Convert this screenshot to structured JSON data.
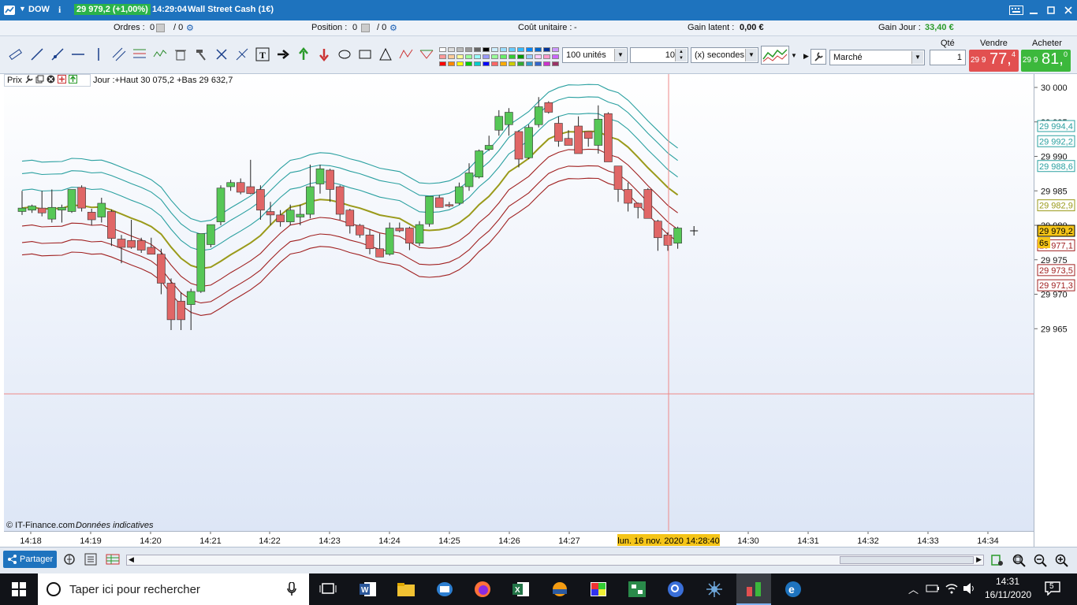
{
  "titlebar": {
    "symbol": "DOW",
    "price_badge": "29 979,2 (+1,00%)",
    "time": "14:29:04",
    "instrument": "Wall Street Cash (1€)"
  },
  "infobar": {
    "orders_label": "Ordres :",
    "orders_value": "0",
    "orders_value2": "/ 0",
    "position_label": "Position :",
    "position_value": "0",
    "position_value2": "/ 0",
    "unit_cost_label": "Coût unitaire :",
    "unit_cost_value": "-",
    "latent_label": "Gain latent :",
    "latent_value": "0,00 €",
    "day_gain_label": "Gain Jour :",
    "day_gain_value": "33,40 €"
  },
  "toolbar": {
    "units_select": "100 unités",
    "interval_value": "10",
    "interval_unit": "(x) secondes",
    "order_type": "Marché",
    "qty_label": "Qté",
    "qty_value": "1",
    "sell_label": "Vendre",
    "buy_label": "Acheter",
    "sell_price_small": "29 9",
    "sell_price_big": "77,",
    "sell_price_sup": "4",
    "buy_price_small": "29 9",
    "buy_price_big": "81,",
    "buy_price_sup": "0"
  },
  "chart_header": {
    "prix_label": "Prix",
    "day_info": "Jour :+Haut 30 075,2 +Bas 29 632,7"
  },
  "credits": {
    "source": "© IT-Finance.com",
    "note": "Données indicatives"
  },
  "yaxis": {
    "ticks": [
      "30 000",
      "29 995",
      "29 990",
      "29 985",
      "29 980",
      "29 975",
      "29 970",
      "29 965"
    ],
    "badges": [
      {
        "text": "29 994,4",
        "color": "#2aa0a0",
        "value": 29994.4
      },
      {
        "text": "29 992,2",
        "color": "#2aa0a0",
        "value": 29992.2
      },
      {
        "text": "29 988,6",
        "color": "#2aa0a0",
        "value": 29988.6
      },
      {
        "text": "29 982,9",
        "color": "#9a9a1a",
        "value": 29982.9
      },
      {
        "text": "29 979,2",
        "color": "#000000",
        "value": 29979.2
      },
      {
        "text": "29 977,1",
        "color": "#a02020",
        "value": 29977.1
      },
      {
        "text": "29 973,5",
        "color": "#a02020",
        "value": 29973.5
      },
      {
        "text": "29 971,3",
        "color": "#a02020",
        "value": 29971.3
      }
    ],
    "countdown": "6s"
  },
  "xaxis": {
    "ticks": [
      "14:18",
      "14:19",
      "14:20",
      "14:21",
      "14:22",
      "14:23",
      "14:24",
      "14:25",
      "14:26",
      "14:27",
      "14:30",
      "14:31",
      "14:32",
      "14:33",
      "14:34"
    ],
    "cursor_label": "lun. 16 nov. 2020 14:28:40"
  },
  "bottombar": {
    "share_label": "Partager"
  },
  "taskbar": {
    "search_placeholder": "Taper ici pour rechercher",
    "clock_time": "14:31",
    "clock_date": "16/11/2020",
    "notif_count": "5"
  },
  "colors": {
    "bull": "#56c756",
    "bear": "#e06666",
    "band_teal": "#2aa0a0",
    "band_red": "#a02020",
    "ma": "#9a9a1a"
  },
  "chart_data": {
    "type": "candlestick",
    "x_label_note": "time (10 s candles)",
    "ylim": [
      29962,
      30002
    ],
    "candles": [
      {
        "t": "14:18:00",
        "o": 29982.0,
        "h": 29985.0,
        "l": 29981.5,
        "c": 29982.5
      },
      {
        "t": "14:18:10",
        "o": 29982.2,
        "h": 29983.0,
        "l": 29981.8,
        "c": 29982.8
      },
      {
        "t": "14:18:20",
        "o": 29982.5,
        "h": 29985.0,
        "l": 29981.3,
        "c": 29981.8
      },
      {
        "t": "14:18:30",
        "o": 29980.9,
        "h": 29985.2,
        "l": 29980.4,
        "c": 29982.6
      },
      {
        "t": "14:18:40",
        "o": 29982.2,
        "h": 29983.0,
        "l": 29980.4,
        "c": 29982.6
      },
      {
        "t": "14:18:50",
        "o": 29982.0,
        "h": 29985.2,
        "l": 29981.8,
        "c": 29985.2
      },
      {
        "t": "14:19:00",
        "o": 29985.5,
        "h": 29985.8,
        "l": 29982.0,
        "c": 29982.5
      },
      {
        "t": "14:19:10",
        "o": 29981.9,
        "h": 29982.4,
        "l": 29980.0,
        "c": 29980.8
      },
      {
        "t": "14:19:20",
        "o": 29981.2,
        "h": 29984.0,
        "l": 29980.4,
        "c": 29983.2
      },
      {
        "t": "14:19:30",
        "o": 29982.0,
        "h": 29982.3,
        "l": 29977.0,
        "c": 29978.1
      },
      {
        "t": "14:19:40",
        "o": 29978.0,
        "h": 29978.6,
        "l": 29974.5,
        "c": 29976.8
      },
      {
        "t": "14:19:50",
        "o": 29977.8,
        "h": 29980.8,
        "l": 29976.6,
        "c": 29976.8
      },
      {
        "t": "14:20:00",
        "o": 29977.8,
        "h": 29978.2,
        "l": 29976.0,
        "c": 29976.4
      },
      {
        "t": "14:20:10",
        "o": 29976.8,
        "h": 29978.2,
        "l": 29975.8,
        "c": 29975.8
      },
      {
        "t": "14:20:20",
        "o": 29975.8,
        "h": 29976.6,
        "l": 29970.0,
        "c": 29971.6
      },
      {
        "t": "14:20:30",
        "o": 29971.6,
        "h": 29972.3,
        "l": 29964.8,
        "c": 29966.3
      },
      {
        "t": "14:20:40",
        "o": 29969.0,
        "h": 29970.3,
        "l": 29964.8,
        "c": 29966.3
      },
      {
        "t": "14:20:50",
        "o": 29968.5,
        "h": 29970.8,
        "l": 29964.8,
        "c": 29970.4
      },
      {
        "t": "14:21:00",
        "o": 29970.4,
        "h": 29977.4,
        "l": 29970.2,
        "c": 29978.8
      },
      {
        "t": "14:21:10",
        "o": 29977.2,
        "h": 29980.1,
        "l": 29976.8,
        "c": 29980.1
      },
      {
        "t": "14:21:20",
        "o": 29980.5,
        "h": 29985.8,
        "l": 29980.0,
        "c": 29985.4
      },
      {
        "t": "14:21:30",
        "o": 29985.6,
        "h": 29986.6,
        "l": 29985.0,
        "c": 29986.2
      },
      {
        "t": "14:21:40",
        "o": 29986.2,
        "h": 29986.8,
        "l": 29984.5,
        "c": 29984.8
      },
      {
        "t": "14:21:50",
        "o": 29985.6,
        "h": 29989.5,
        "l": 29984.5,
        "c": 29984.6
      },
      {
        "t": "14:22:00",
        "o": 29985.2,
        "h": 29985.8,
        "l": 29980.8,
        "c": 29982.2
      },
      {
        "t": "14:22:10",
        "o": 29982.0,
        "h": 29983.4,
        "l": 29980.0,
        "c": 29981.5
      },
      {
        "t": "14:22:20",
        "o": 29981.5,
        "h": 29982.2,
        "l": 29979.8,
        "c": 29980.5
      },
      {
        "t": "14:22:30",
        "o": 29980.5,
        "h": 29983.0,
        "l": 29980.0,
        "c": 29982.2
      },
      {
        "t": "14:22:40",
        "o": 29981.2,
        "h": 29983.0,
        "l": 29980.0,
        "c": 29981.6
      },
      {
        "t": "14:22:50",
        "o": 29981.6,
        "h": 29988.8,
        "l": 29981.0,
        "c": 29985.6
      },
      {
        "t": "14:23:00",
        "o": 29986.0,
        "h": 29988.8,
        "l": 29984.6,
        "c": 29988.2
      },
      {
        "t": "14:23:10",
        "o": 29988.0,
        "h": 29988.2,
        "l": 29983.4,
        "c": 29985.2
      },
      {
        "t": "14:23:20",
        "o": 29985.6,
        "h": 29985.8,
        "l": 29980.8,
        "c": 29981.6
      },
      {
        "t": "14:23:30",
        "o": 29982.2,
        "h": 29982.4,
        "l": 29978.8,
        "c": 29979.9
      },
      {
        "t": "14:23:40",
        "o": 29980.0,
        "h": 29980.2,
        "l": 29978.2,
        "c": 29978.6
      },
      {
        "t": "14:23:50",
        "o": 29978.6,
        "h": 29979.4,
        "l": 29975.8,
        "c": 29976.6
      },
      {
        "t": "14:24:00",
        "o": 29976.6,
        "h": 29978.8,
        "l": 29975.4,
        "c": 29975.4
      },
      {
        "t": "14:24:10",
        "o": 29975.8,
        "h": 29980.4,
        "l": 29975.6,
        "c": 29979.6
      },
      {
        "t": "14:24:20",
        "o": 29979.6,
        "h": 29980.4,
        "l": 29979.0,
        "c": 29979.2
      },
      {
        "t": "14:24:30",
        "o": 29979.6,
        "h": 29979.8,
        "l": 29976.4,
        "c": 29977.4
      },
      {
        "t": "14:24:40",
        "o": 29977.4,
        "h": 29980.6,
        "l": 29977.0,
        "c": 29980.1
      },
      {
        "t": "14:24:50",
        "o": 29980.2,
        "h": 29984.2,
        "l": 29979.8,
        "c": 29984.2
      },
      {
        "t": "14:25:00",
        "o": 29984.0,
        "h": 29984.4,
        "l": 29983.0,
        "c": 29982.6
      },
      {
        "t": "14:25:10",
        "o": 29983.0,
        "h": 29983.4,
        "l": 29982.6,
        "c": 29982.8
      },
      {
        "t": "14:25:20",
        "o": 29983.2,
        "h": 29986.2,
        "l": 29983.0,
        "c": 29985.6
      },
      {
        "t": "14:25:30",
        "o": 29985.6,
        "h": 29989.0,
        "l": 29985.0,
        "c": 29987.6
      },
      {
        "t": "14:25:40",
        "o": 29987.0,
        "h": 29991.0,
        "l": 29986.8,
        "c": 29990.8
      },
      {
        "t": "14:25:50",
        "o": 29991.0,
        "h": 29993.0,
        "l": 29990.8,
        "c": 29991.6
      },
      {
        "t": "14:26:00",
        "o": 29993.8,
        "h": 29996.7,
        "l": 29993.0,
        "c": 29995.8
      },
      {
        "t": "14:26:10",
        "o": 29994.6,
        "h": 29997.0,
        "l": 29993.0,
        "c": 29996.4
      },
      {
        "t": "14:26:20",
        "o": 29993.6,
        "h": 29993.8,
        "l": 29988.4,
        "c": 29989.6
      },
      {
        "t": "14:26:30",
        "o": 29989.8,
        "h": 29994.6,
        "l": 29989.6,
        "c": 29994.2
      },
      {
        "t": "14:26:40",
        "o": 29994.6,
        "h": 29998.6,
        "l": 29994.2,
        "c": 29997.2
      },
      {
        "t": "14:26:50",
        "o": 29997.8,
        "h": 29998.0,
        "l": 29996.2,
        "c": 29996.4
      },
      {
        "t": "14:27:00",
        "o": 29994.8,
        "h": 29995.8,
        "l": 29991.4,
        "c": 29992.2
      },
      {
        "t": "14:27:10",
        "o": 29992.6,
        "h": 29993.8,
        "l": 29991.6,
        "c": 29991.6
      },
      {
        "t": "14:27:20",
        "o": 29994.4,
        "h": 29995.8,
        "l": 29990.4,
        "c": 29990.4
      },
      {
        "t": "14:27:30",
        "o": 29993.6,
        "h": 29993.4,
        "l": 29991.4,
        "c": 29992.6
      },
      {
        "t": "14:27:40",
        "o": 29991.6,
        "h": 29997.4,
        "l": 29990.4,
        "c": 29995.4
      },
      {
        "t": "14:27:50",
        "o": 29996.2,
        "h": 29996.4,
        "l": 29989.2,
        "c": 29989.2
      },
      {
        "t": "14:28:00",
        "o": 29988.6,
        "h": 29988.6,
        "l": 29983.4,
        "c": 29985.2
      },
      {
        "t": "14:28:10",
        "o": 29985.2,
        "h": 29986.2,
        "l": 29982.0,
        "c": 29983.2
      },
      {
        "t": "14:28:20",
        "o": 29983.2,
        "h": 29983.3,
        "l": 29981.0,
        "c": 29982.6
      },
      {
        "t": "14:28:30",
        "o": 29985.2,
        "h": 29985.4,
        "l": 29981.0,
        "c": 29981.0
      },
      {
        "t": "14:28:40",
        "o": 29980.6,
        "h": 29980.8,
        "l": 29976.3,
        "c": 29978.2
      },
      {
        "t": "14:28:50",
        "o": 29978.6,
        "h": 29979.0,
        "l": 29976.3,
        "c": 29977.1
      },
      {
        "t": "14:29:00",
        "o": 29977.4,
        "h": 29979.8,
        "l": 29976.6,
        "c": 29979.6
      }
    ],
    "last_tick": {
      "t": "14:29:04",
      "value": 29979.2
    }
  }
}
